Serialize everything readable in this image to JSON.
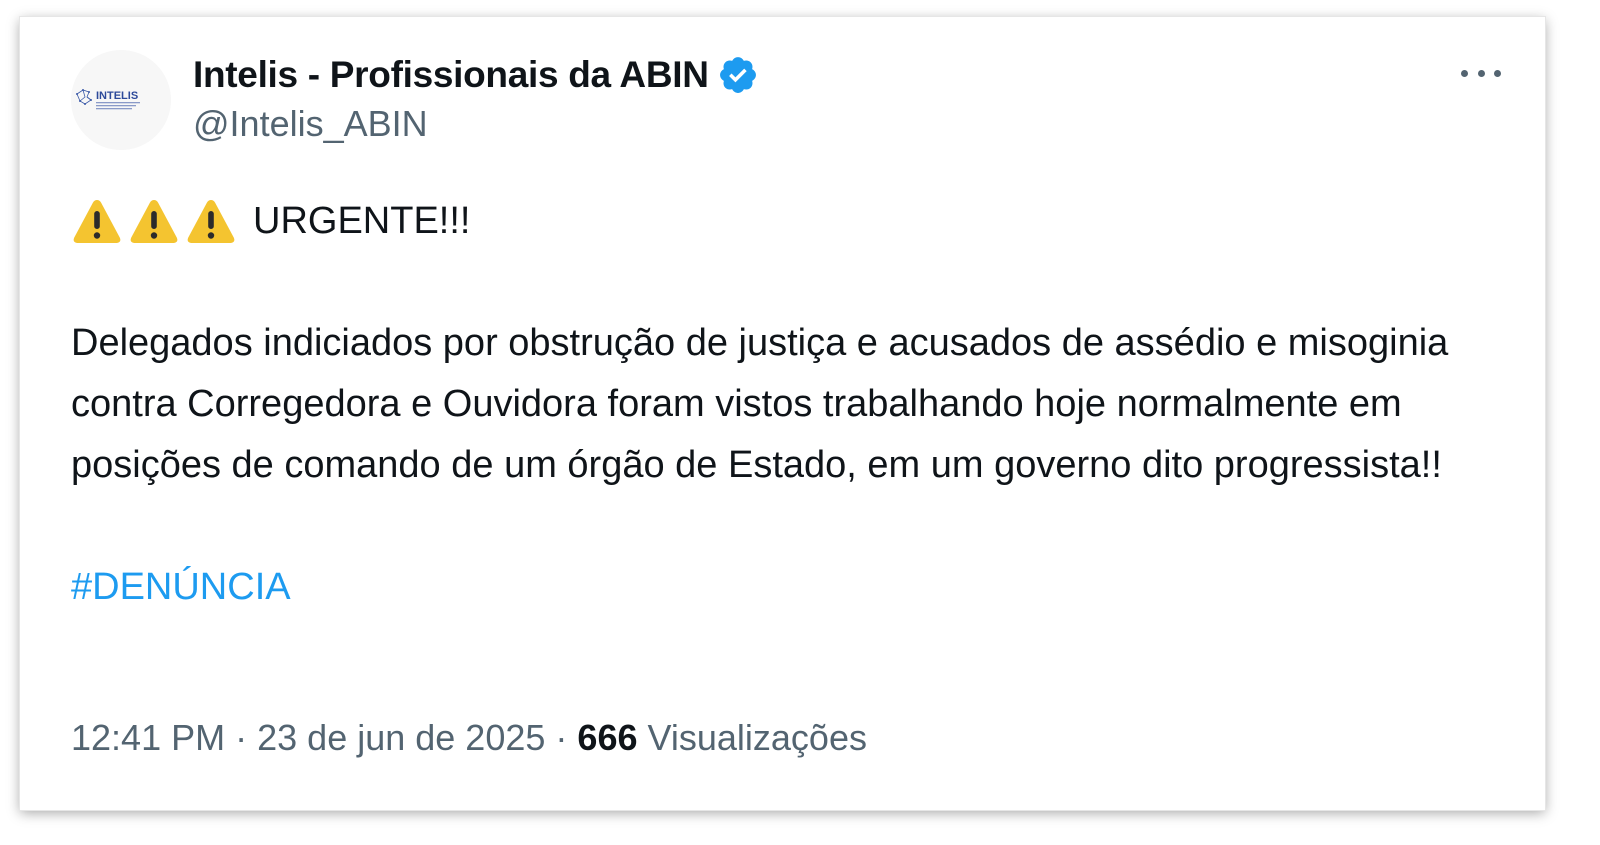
{
  "account": {
    "display_name": "Intelis - Profissionais da ABIN",
    "handle": "@Intelis_ABIN",
    "avatar_text": "INTELIS",
    "verified_color": "#1d9bf0"
  },
  "tweet": {
    "urgent_label": "URGENTE!!!",
    "body": "Delegados indiciados por obstrução de justiça e acusados de assédio e misoginia contra Corregedora e Ouvidora foram vistos trabalhando hoje normalmente em posições de comando de um órgão de Estado, em um governo dito progressista!!",
    "hashtag": "#DENÚNCIA"
  },
  "meta": {
    "time": "12:41 PM",
    "separator": "·",
    "date": "23 de jun de 2025",
    "views_count": "666",
    "views_label": "Visualizações"
  },
  "colors": {
    "text": "#0f1419",
    "secondary": "#536471",
    "link": "#1d9bf0",
    "warning": "#f4c430"
  }
}
